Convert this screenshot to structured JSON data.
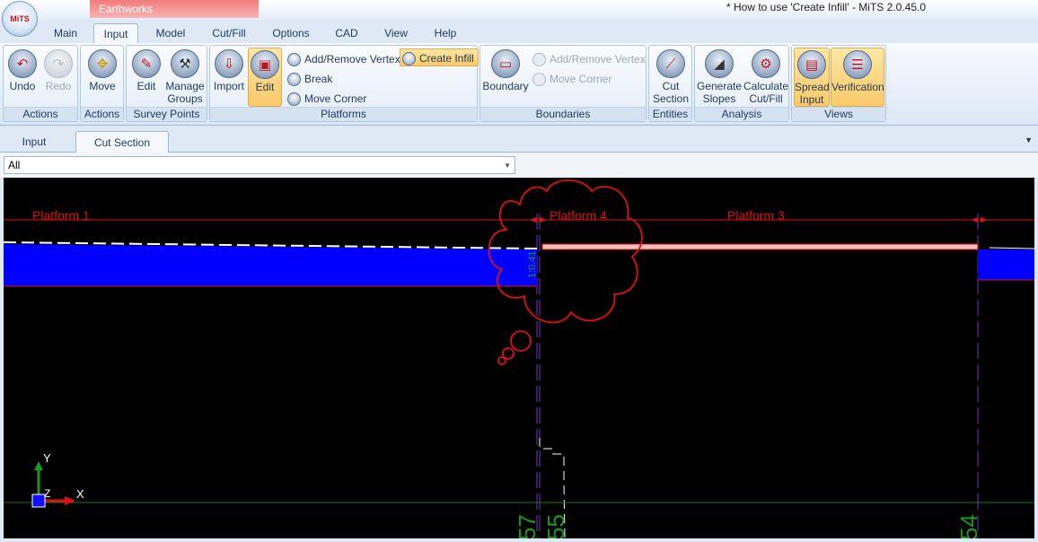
{
  "window": {
    "title": "* How to use 'Create Infill'  - MiTS 2.0.45.0",
    "context_tab": "Earthworks",
    "orb_label": "MiTS"
  },
  "menu_tabs": [
    "Main",
    "Input",
    "Model",
    "Cut/Fill",
    "Options",
    "CAD",
    "View",
    "Help"
  ],
  "active_menu_tab": "Input",
  "ribbon": {
    "groups": {
      "actions1": "Actions",
      "actions2": "Actions",
      "survey_points": "Survey Points",
      "platforms": "Platforms",
      "boundaries": "Boundaries",
      "entities": "Entities",
      "analysis": "Analysis",
      "views": "Views"
    },
    "buttons": {
      "undo": "Undo",
      "redo": "Redo",
      "move": "Move",
      "edit_points": "Edit",
      "manage_groups_1": "Manage",
      "manage_groups_2": "Groups",
      "import": "Import",
      "edit_platforms": "Edit",
      "add_remove_vertex": "Add/Remove Vertex",
      "break": "Break",
      "move_corner": "Move Corner",
      "create_infill": "Create Infill",
      "boundary": "Boundary",
      "boundary_add_remove_vertex": "Add/Remove Vertex",
      "boundary_move_corner": "Move Corner",
      "cut_section_1": "Cut",
      "cut_section_2": "Section",
      "generate_slopes_1": "Generate",
      "generate_slopes_2": "Slopes",
      "calculate_cutfill_1": "Calculate",
      "calculate_cutfill_2": "Cut/Fill",
      "spread_input_1": "Spread",
      "spread_input_2": "Input",
      "verification": "Verification"
    }
  },
  "doc_tabs": [
    "Input",
    "Cut Section"
  ],
  "active_doc_tab": "Cut Section",
  "filter": {
    "value": "All"
  },
  "canvas": {
    "labels": {
      "platform1": "Platform 1",
      "platform4": "Platform 4",
      "platform3": "Platform 3",
      "slope_label": "1:0.41",
      "axis_y": "Y",
      "axis_x": "X",
      "axis_z": "Z",
      "chainage1": "57",
      "chainage2": "55",
      "chainage3": "54"
    },
    "colors": {
      "background": "#000000",
      "fill": "#0000ff",
      "platform_line": "#e01010",
      "infill_highlight": "#ffc0c0",
      "dashed_terrain": "#ffffff",
      "cloud": "#e01010",
      "chainage_text": "#1a9a1a",
      "guide_line": "#7b2fbf"
    }
  }
}
